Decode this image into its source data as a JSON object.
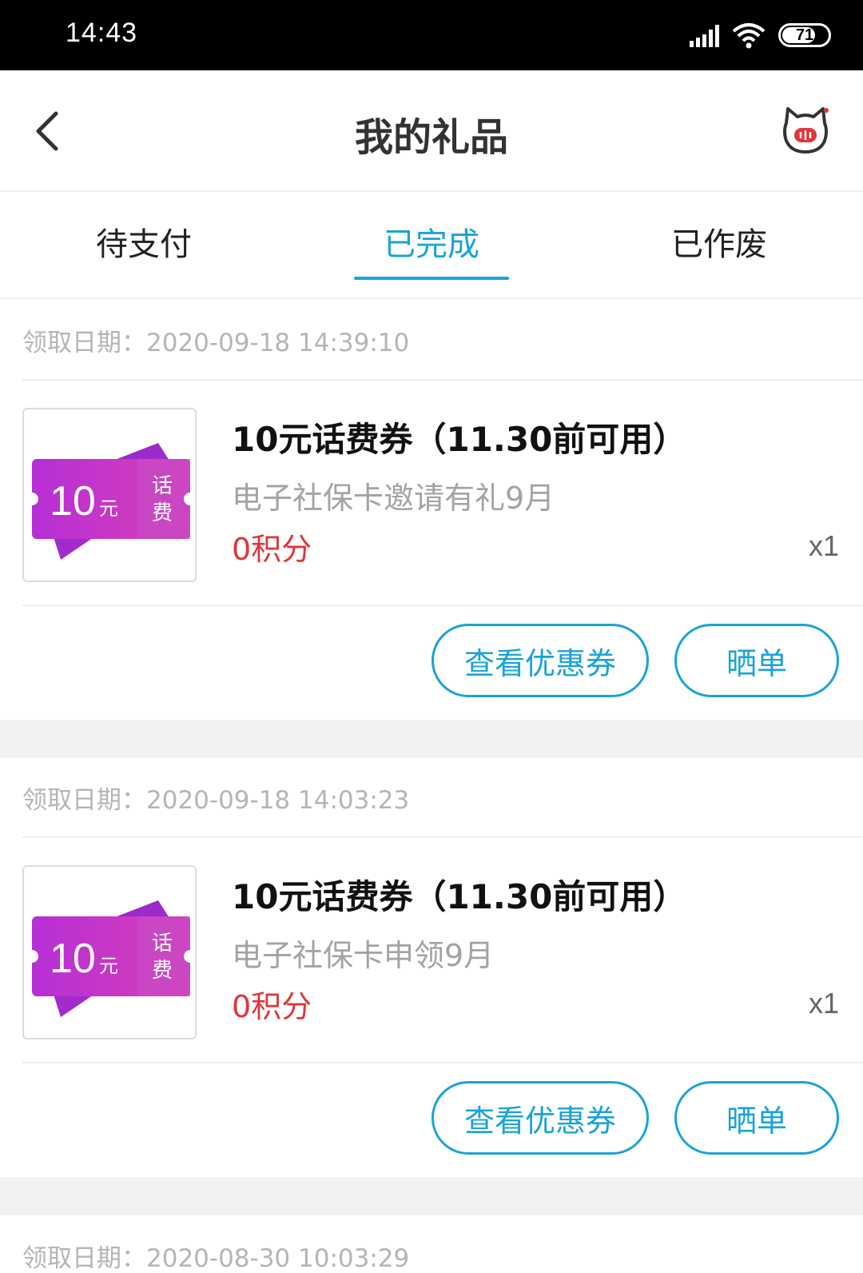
{
  "status_bar": {
    "time": "14:43",
    "battery": "71"
  },
  "header": {
    "title": "我的礼品"
  },
  "tabs": [
    {
      "label": "待支付"
    },
    {
      "label": "已完成"
    },
    {
      "label": "已作废"
    }
  ],
  "colors": {
    "accent": "#1aa3d8",
    "points": "#e0353a",
    "coupon_purple": "#b62fd6",
    "coupon_magenta": "#d93fb5"
  },
  "coupon_art": {
    "amount": "10",
    "unit": "元",
    "label_top": "话",
    "label_bottom": "费"
  },
  "orders": [
    {
      "date": "领取日期：2020-09-18 14:39:10",
      "title": "10元话费券（11.30前可用）",
      "subtitle": "电子社保卡邀请有礼9月",
      "points": "0积分",
      "qty": "x1",
      "view_label": "查看优惠券",
      "share_label": "晒单"
    },
    {
      "date": "领取日期：2020-09-18 14:03:23",
      "title": "10元话费券（11.30前可用）",
      "subtitle": "电子社保卡申领9月",
      "points": "0积分",
      "qty": "x1",
      "view_label": "查看优惠券",
      "share_label": "晒单"
    },
    {
      "date": "领取日期：2020-08-30 10:03:29"
    }
  ]
}
